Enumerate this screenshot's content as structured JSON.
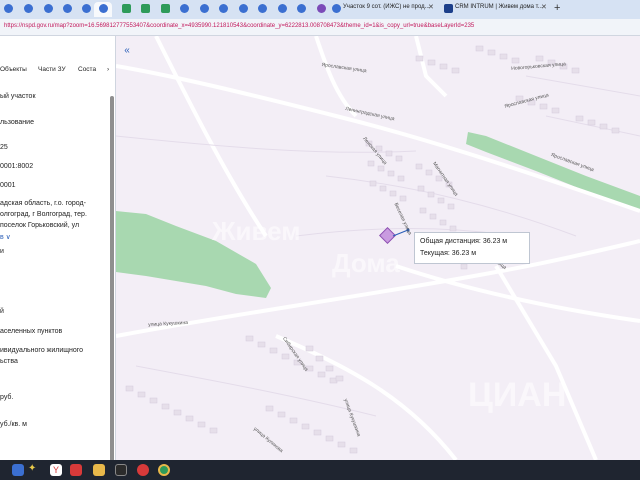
{
  "browser": {
    "tabs": [
      {
        "title": "Участок 9 сот. (ИЖС) не прод...",
        "icon": "doc-icon"
      },
      {
        "title": "CRM INTRUM | Живем дома т...",
        "icon": "crm-icon"
      }
    ],
    "new_tab_label": "+",
    "url": "https://nspd.gov.ru/map?zoom=16.569812777553407&coordinate_x=4935990.121810543&coordinate_y=6222813.008708473&theme_id=1&is_copy_url=true&baseLayerId=235"
  },
  "panel": {
    "collapse_label": "«",
    "tabs": [
      "Объекты",
      "Части ЗУ",
      "Соста",
      "›"
    ],
    "lines": [
      {
        "text": "ый участок",
        "link": false
      },
      {
        "text": "льзование",
        "link": false
      },
      {
        "text": "25",
        "link": false
      },
      {
        "text": "0001:8002",
        "link": false
      },
      {
        "text": "0001",
        "link": false
      },
      {
        "text": "адская область, г.о. город-",
        "link": false
      },
      {
        "text": "олгоград, г Волгоград, тер.",
        "link": false
      },
      {
        "text": "поселок Горьковский, ул",
        "link": false
      },
      {
        "text": "в ∨",
        "link": true
      },
      {
        "text": "и",
        "link": false
      },
      {
        "text": "й",
        "link": false
      },
      {
        "text": "аселенных пунктов",
        "link": false
      },
      {
        "text": "ивидуального жилищного",
        "link": false
      },
      {
        "text": "ьства",
        "link": false
      },
      {
        "text": "руб.",
        "link": false
      },
      {
        "text": "уб./кв. м",
        "link": false
      }
    ]
  },
  "map": {
    "streets": [
      "Ярославская улица",
      "Новогорьковская улица",
      "Ленинградская улица",
      "Ярославская улица",
      "Ярославская улица",
      "Ленская улица",
      "Магнитная улица",
      "Веселая улица",
      "Таганская улица",
      "улица Кукушкина",
      "Сибирская улица",
      "улица Куликова",
      "улица Кукушкина"
    ],
    "watermarks": [
      "Живем",
      "Дома",
      "ЦИАН"
    ],
    "measure": {
      "total_label": "Общая дистанция:",
      "total_value": "36.23 м",
      "current_label": "Текущая:",
      "current_value": "36.23 м"
    },
    "colors": {
      "background": "#f3eef6",
      "green_area": "#a8d8b0",
      "parcel": "#c99be0",
      "road": "#ffffff"
    }
  },
  "taskbar": {
    "items": [
      "start-icon",
      "copilot-icon",
      "yandex-icon",
      "yandex-browser-icon",
      "folder-icon",
      "terminal-icon",
      "opera-icon",
      "chrome-icon"
    ]
  }
}
